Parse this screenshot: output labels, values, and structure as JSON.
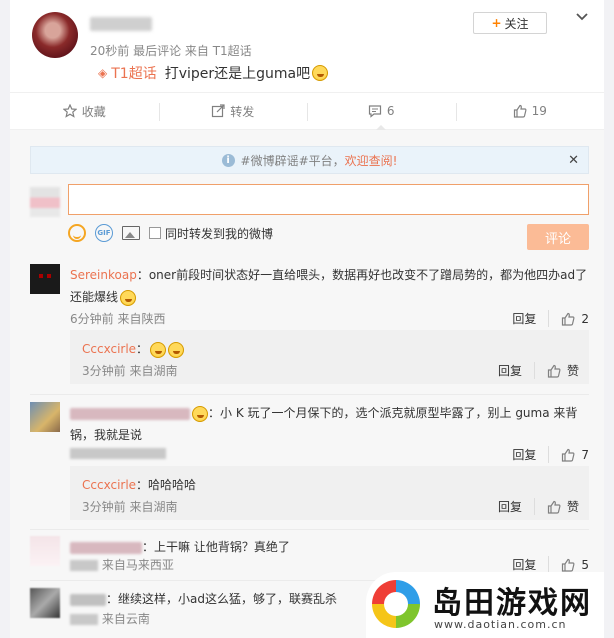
{
  "post": {
    "meta": "20秒前 最后评论 来自 T1超话",
    "topic": "T1超话",
    "text": "打viper还是上guma吧",
    "follow_label": "关注"
  },
  "actions": [
    {
      "label": "收藏",
      "icon": "star-icon"
    },
    {
      "label": "转发",
      "icon": "share-icon"
    },
    {
      "label": "6",
      "icon": "comment-icon"
    },
    {
      "label": "19",
      "icon": "thumbs-up-icon"
    }
  ],
  "notice": {
    "text": "#微博辟谣#平台，",
    "link": "欢迎查阅!"
  },
  "composer": {
    "value": "",
    "placeholder": "",
    "repost_label": "同时转发到我的微博",
    "submit_label": "评论"
  },
  "comments": [
    {
      "user": "Sereinkoap",
      "text": "：oner前段时间状态好一直给喂头，数据再好也改变不了蹭局势的，都为他四办ad了还能爆线",
      "meta": "6分钟前 来自陕西",
      "reply_label": "回复",
      "likes": "2",
      "sub": {
        "user": "Cccxcirle",
        "text": "：",
        "meta": "3分钟前 来自湖南",
        "reply_label": "回复",
        "likes": "赞"
      }
    },
    {
      "text": "：小 K 玩了一个月保下的，选个派克就原型毕露了，别上 guma 来背锅，我就是说",
      "reply_label": "回复",
      "likes": "7",
      "sub": {
        "user": "Cccxcirle",
        "text": "：哈哈哈哈",
        "meta": "3分钟前 来自湖南",
        "reply_label": "回复",
        "likes": "赞"
      }
    },
    {
      "text": "：上干嘛 让他背锅？真绝了",
      "meta": "来自马来西亚",
      "reply_label": "回复",
      "likes": "5"
    },
    {
      "text": "：继续这样，小ad这么猛，够了，联赛乱杀",
      "meta": "来自云南"
    }
  ],
  "watermark": {
    "title": "岛田游戏网",
    "url": "www.daotian.com.cn"
  },
  "colors": {
    "accent": "#eb7350",
    "follow_plus": "#ff8200",
    "submit_disabled": "#fbbb96",
    "notice_bg": "#eaf3fa"
  }
}
